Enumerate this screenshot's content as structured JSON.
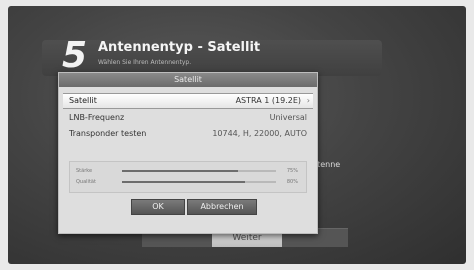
{
  "header": {
    "step": "5",
    "title": "Antennentyp - Satellit",
    "subtitle": "Wählen Sie Ihren Antennentyp."
  },
  "background": {
    "partial_value": "0",
    "partial_label": "ntenne",
    "next_button": "Weiter"
  },
  "dialog": {
    "title": "Satellit",
    "rows": [
      {
        "label": "Satellit",
        "value": "ASTRA 1 (19.2E)"
      },
      {
        "label": "LNB-Frequenz",
        "value": "Universal"
      },
      {
        "label": "Transponder testen",
        "value": "10744, H, 22000, AUTO"
      }
    ],
    "signal": [
      {
        "label": "Stärke",
        "percent_text": "75%",
        "fraction": 0.75
      },
      {
        "label": "Qualität",
        "percent_text": "80%",
        "fraction": 0.8
      }
    ],
    "ok_label": "OK",
    "cancel_label": "Abbrechen"
  }
}
